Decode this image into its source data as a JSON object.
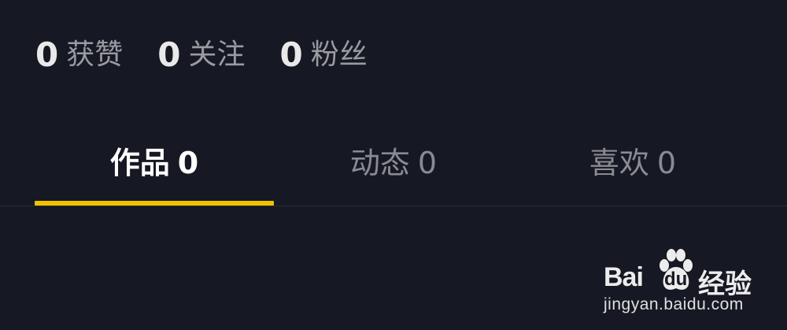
{
  "stats": [
    {
      "count": "0",
      "label": "获赞"
    },
    {
      "count": "0",
      "label": "关注"
    },
    {
      "count": "0",
      "label": "粉丝"
    }
  ],
  "tabs": [
    {
      "label": "作品",
      "count": "0",
      "active": true
    },
    {
      "label": "动态",
      "count": "0",
      "active": false
    },
    {
      "label": "喜欢",
      "count": "0",
      "active": false
    }
  ],
  "colors": {
    "background": "#161823",
    "active_tab_indicator": "#f2c200",
    "active_text": "#ffffff",
    "inactive_text": "#8a8b91"
  },
  "watermark": {
    "brand_left": "Bai",
    "brand_paw": "du",
    "brand_right": "经验",
    "url": "jingyan.baidu.com"
  }
}
